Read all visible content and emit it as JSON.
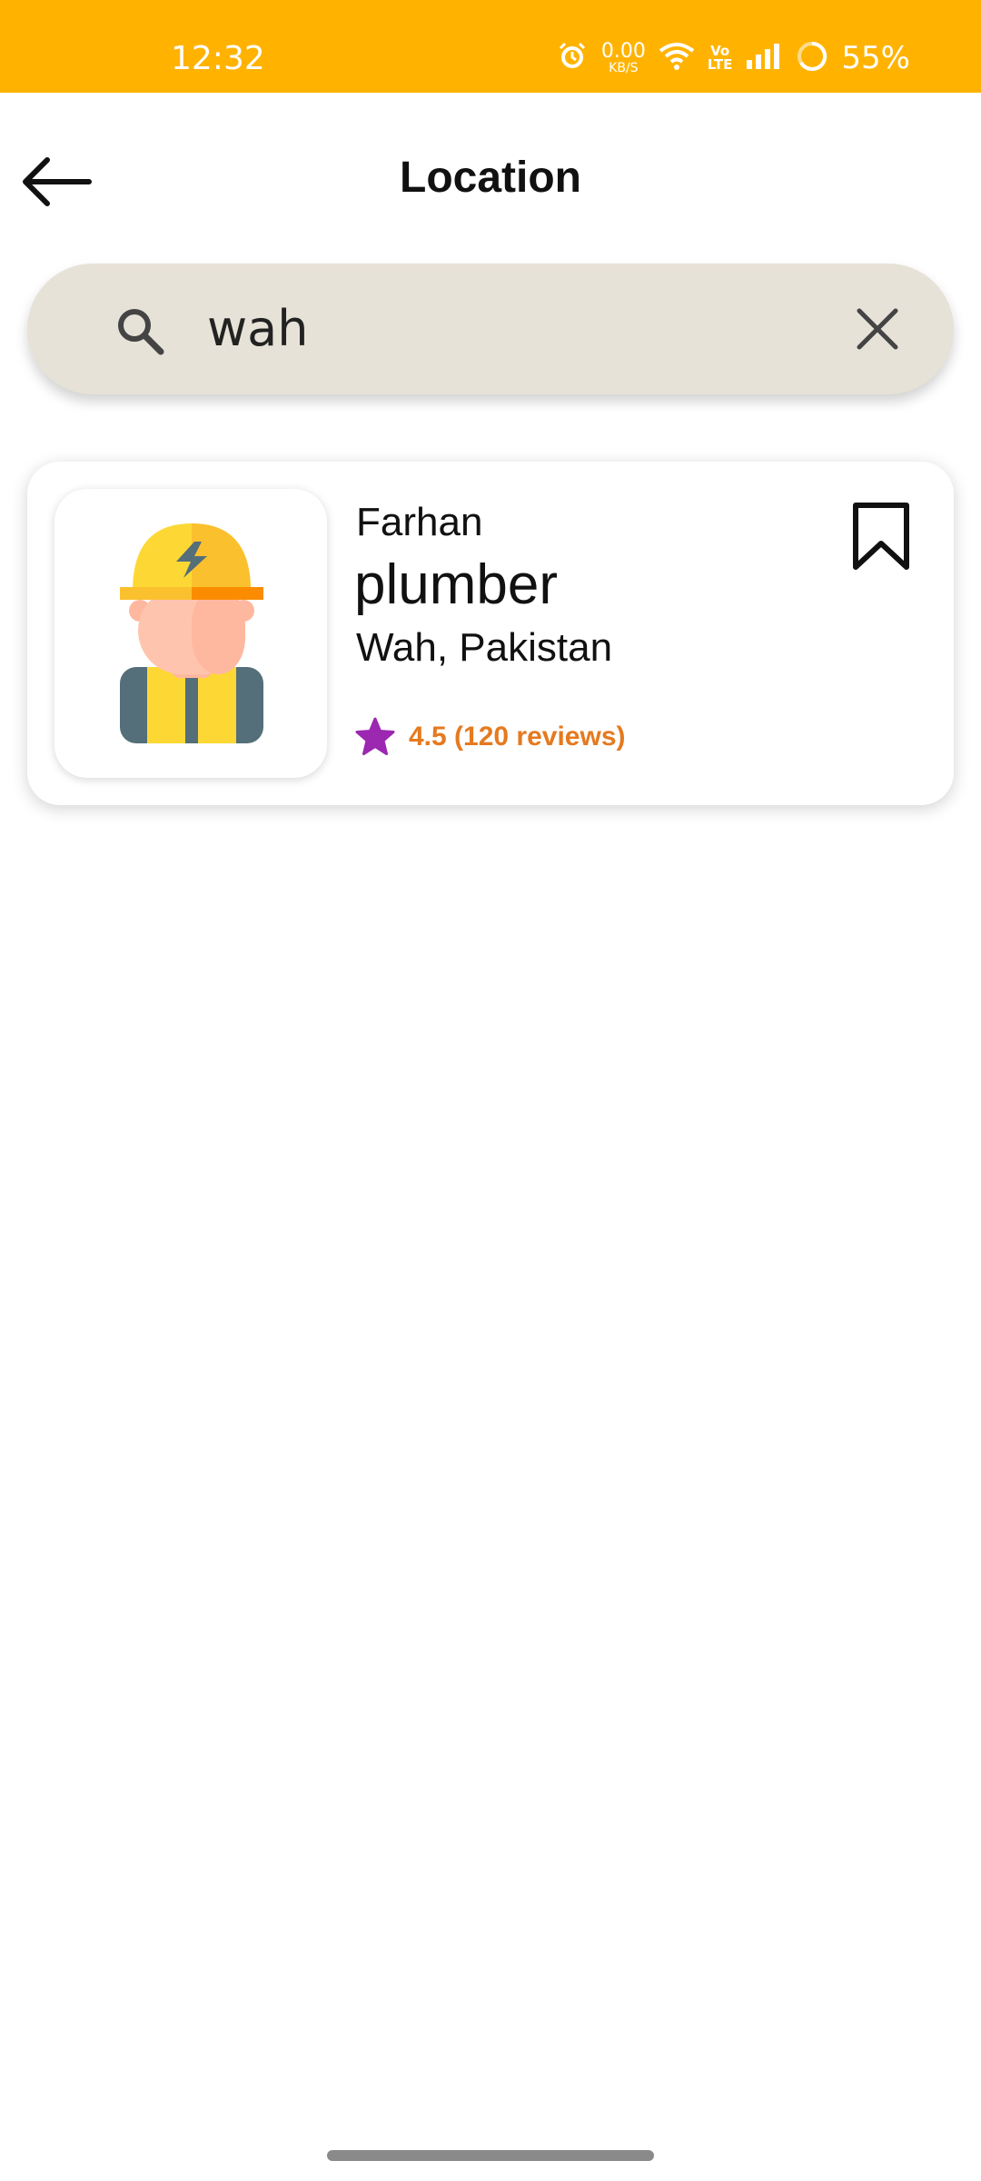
{
  "status_bar": {
    "time": "12:32",
    "net_speed": "0.00",
    "net_speed_unit": "KB/S",
    "volte_top": "Vo",
    "volte_bottom": "LTE",
    "battery": "55%",
    "icons": [
      "alarm-icon",
      "wifi-icon",
      "volte-icon",
      "signal-icon",
      "battery-ring-icon"
    ],
    "bg_color": "#FFB300"
  },
  "header": {
    "title": "Location",
    "back_icon": "arrow-left-icon"
  },
  "search": {
    "value": "wah",
    "search_icon": "search-icon",
    "clear_icon": "close-icon",
    "bg_color": "#E7E2D8"
  },
  "results": [
    {
      "name": "Farhan",
      "role": "plumber",
      "location": "Wah, Pakistan",
      "rating_text": "4.5 (120 reviews)",
      "rating": 4.5,
      "reviews": 120,
      "avatar_icon": "worker-avatar-icon",
      "bookmark_icon": "bookmark-icon",
      "star_color": "#9C27B0",
      "rating_color": "#E57A1F"
    }
  ]
}
